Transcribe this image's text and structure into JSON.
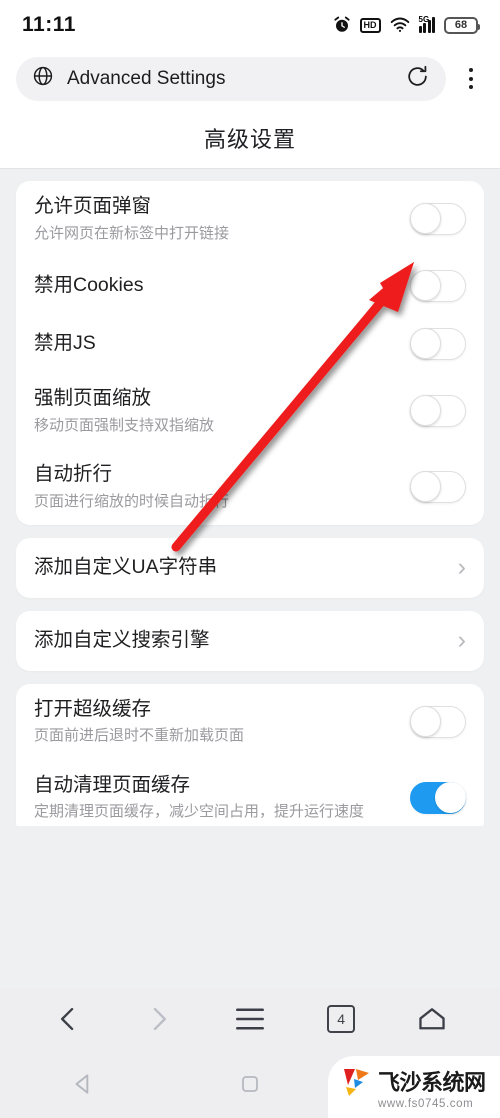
{
  "status_bar": {
    "time": "11:11",
    "icons": [
      "alarm-icon",
      "hd-icon",
      "wifi-icon",
      "signal-5g-icon",
      "battery-icon"
    ],
    "hd_label": "HD",
    "network_label": "5G",
    "battery_level": "68"
  },
  "browser": {
    "address_icon": "globe-icon",
    "address_title": "Advanced Settings",
    "refresh_icon": "refresh-icon",
    "menu_icon": "more-vertical-icon"
  },
  "page": {
    "title": "高级设置"
  },
  "groups": [
    {
      "name": "page-behavior-group",
      "rows": [
        {
          "title": "允许页面弹窗",
          "subtitle": "允许网页在新标签中打开链接",
          "control": "toggle",
          "value": "off"
        },
        {
          "title": "禁用Cookies",
          "subtitle": "",
          "control": "toggle",
          "value": "off"
        },
        {
          "title": "禁用JS",
          "subtitle": "",
          "control": "toggle",
          "value": "off"
        },
        {
          "title": "强制页面缩放",
          "subtitle": "移动页面强制支持双指缩放",
          "control": "toggle",
          "value": "off"
        },
        {
          "title": "自动折行",
          "subtitle": "页面进行缩放的时候自动折行",
          "control": "toggle",
          "value": "off"
        }
      ]
    },
    {
      "name": "custom-ua-group",
      "rows": [
        {
          "title": "添加自定义UA字符串",
          "subtitle": "",
          "control": "chevron",
          "value": ""
        }
      ]
    },
    {
      "name": "custom-search-group",
      "rows": [
        {
          "title": "添加自定义搜索引擎",
          "subtitle": "",
          "control": "chevron",
          "value": ""
        }
      ]
    },
    {
      "name": "cache-group",
      "rows": [
        {
          "title": "打开超级缓存",
          "subtitle": "页面前进后退时不重新加载页面",
          "control": "toggle",
          "value": "off"
        },
        {
          "title": "自动清理页面缓存",
          "subtitle": "定期清理页面缓存，减少空间占用，提升运行速度",
          "control": "toggle",
          "value": "on"
        }
      ]
    }
  ],
  "annotation": {
    "type": "arrow",
    "color": "#ee1c1c",
    "points_to": "allow-popup-toggle"
  },
  "browser_nav": {
    "back_icon": "chevron-left-icon",
    "forward_icon": "chevron-right-icon",
    "menu_icon": "hamburger-icon",
    "tabs_count": "4",
    "home_icon": "home-icon"
  },
  "android_nav": {
    "back_icon": "triangle-back-icon",
    "recents_icon": "square-recents-icon"
  },
  "watermark": {
    "name": "飞沙系统网",
    "url": "www.fs0745.com",
    "colors": {
      "red": "#e02020",
      "orange": "#f07818",
      "blue": "#1e8ce0",
      "yellow": "#f5b515"
    }
  },
  "theme": {
    "accent": "#1e9bf0",
    "page_bg": "#eef0f2",
    "card_bg": "#ffffff"
  }
}
